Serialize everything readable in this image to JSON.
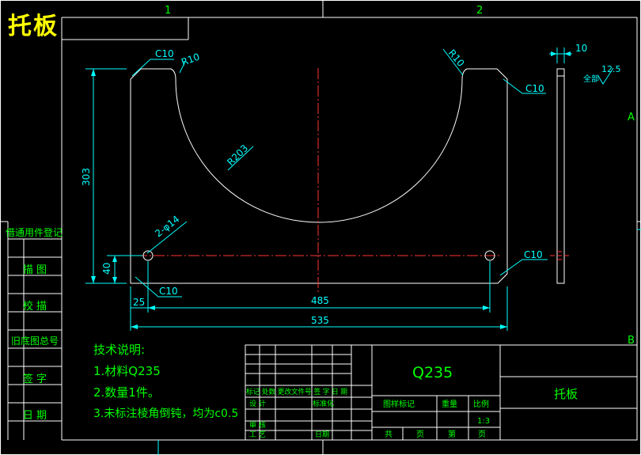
{
  "title": "托板",
  "frame": {
    "zone_top_1": "1",
    "zone_top_2": "2",
    "zone_side_a": "A",
    "zone_side_b": "B"
  },
  "dimensions": {
    "chamfer_top_left": "C10",
    "chamfer_top_right": "C10",
    "chamfer_bottom_left": "C10",
    "chamfer_bottom_right": "C10",
    "fillet_left": "R10",
    "fillet_right": "R10",
    "arc_radius": "R203",
    "hole_spec": "2-φ14",
    "height_total": "303",
    "height_holes": "40",
    "hole_offset": "25",
    "hole_spacing": "485",
    "width_total": "535",
    "thickness": "10",
    "roughness_label": "全部",
    "roughness_value": "12.5"
  },
  "tech_notes": {
    "heading": "技术说明:",
    "note1": "1.材料Q235",
    "note2": "2.数量1件。",
    "note3": "3.未标注棱角倒钝，均为c0.5"
  },
  "side_table": [
    "借通用件登记",
    "描  图",
    "校  描",
    "旧底图总号",
    "签  字",
    "日  期"
  ],
  "title_block": {
    "material": "Q235",
    "part_name": "托板",
    "labels": {
      "revision_header": "标记 处数 更改文件号 签 字 日 期",
      "design": "设 计",
      "standardize": "标准化",
      "review": "审 核",
      "process": "工 艺",
      "date": "日期",
      "stage_mark": "图样标记",
      "weight": "重量",
      "scale_label": "比例",
      "scale_value": "1:3",
      "total": "共",
      "sheets": "页",
      "sheet_no": "第",
      "page": "页"
    }
  }
}
